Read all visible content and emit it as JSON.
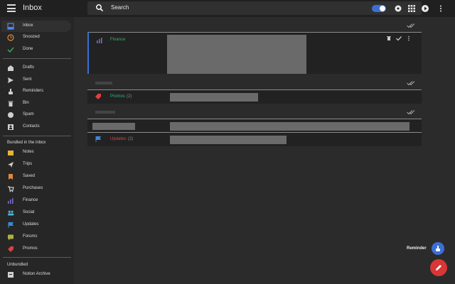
{
  "app": {
    "title": "Inbox"
  },
  "search": {
    "label": "Search"
  },
  "sidebar": {
    "primary": [
      {
        "label": "Inbox",
        "icon": "inbox-icon",
        "color": "#4a8af4",
        "active": true
      },
      {
        "label": "Snoozed",
        "icon": "clock-icon",
        "color": "#e5883a"
      },
      {
        "label": "Done",
        "icon": "check-icon",
        "color": "#3fae5b"
      }
    ],
    "secondary": [
      {
        "label": "Drafts",
        "icon": "drafts-icon",
        "color": "#cfcfcf"
      },
      {
        "label": "Sent",
        "icon": "send-icon",
        "color": "#cfcfcf"
      },
      {
        "label": "Reminders",
        "icon": "reminder-hand-icon",
        "color": "#cfcfcf"
      },
      {
        "label": "Bin",
        "icon": "trash-icon",
        "color": "#cfcfcf"
      },
      {
        "label": "Spam",
        "icon": "spam-icon",
        "color": "#cfcfcf"
      },
      {
        "label": "Contacts",
        "icon": "contacts-icon",
        "color": "#cfcfcf"
      }
    ],
    "bundled_label": "Bundled in the inbox",
    "bundled": [
      {
        "label": "Notes",
        "icon": "notes-icon",
        "color": "#e5b43a"
      },
      {
        "label": "Trips",
        "icon": "plane-icon",
        "color": "#cfcfcf"
      },
      {
        "label": "Saved",
        "icon": "bookmark-icon",
        "color": "#e5883a"
      },
      {
        "label": "Purchases",
        "icon": "cart-icon",
        "color": "#cfcfcf"
      },
      {
        "label": "Finance",
        "icon": "finance-chart-icon",
        "color": "#7a6fd6"
      },
      {
        "label": "Social",
        "icon": "social-people-icon",
        "color": "#4ab0d6"
      },
      {
        "label": "Updates",
        "icon": "flag-icon",
        "color": "#3b8ad6"
      },
      {
        "label": "Forums",
        "icon": "forum-icon",
        "color": "#b0b040"
      },
      {
        "label": "Promos",
        "icon": "tag-icon",
        "color": "#e04040"
      }
    ],
    "unbundled_label": "Unbundled",
    "unbundled": [
      {
        "label": "Notion Archive",
        "icon": "archive-icon",
        "color": "#cfcfcf"
      }
    ]
  },
  "main": {
    "finance": {
      "label": "Finance",
      "color": "#3fae5b"
    },
    "promos": {
      "label": "Promos",
      "count": "(2)",
      "color": "#2fb58a"
    },
    "updates": {
      "label": "Updates",
      "count": "(2)",
      "color": "#e04040"
    }
  },
  "fab": {
    "reminder_label": "Reminder"
  }
}
